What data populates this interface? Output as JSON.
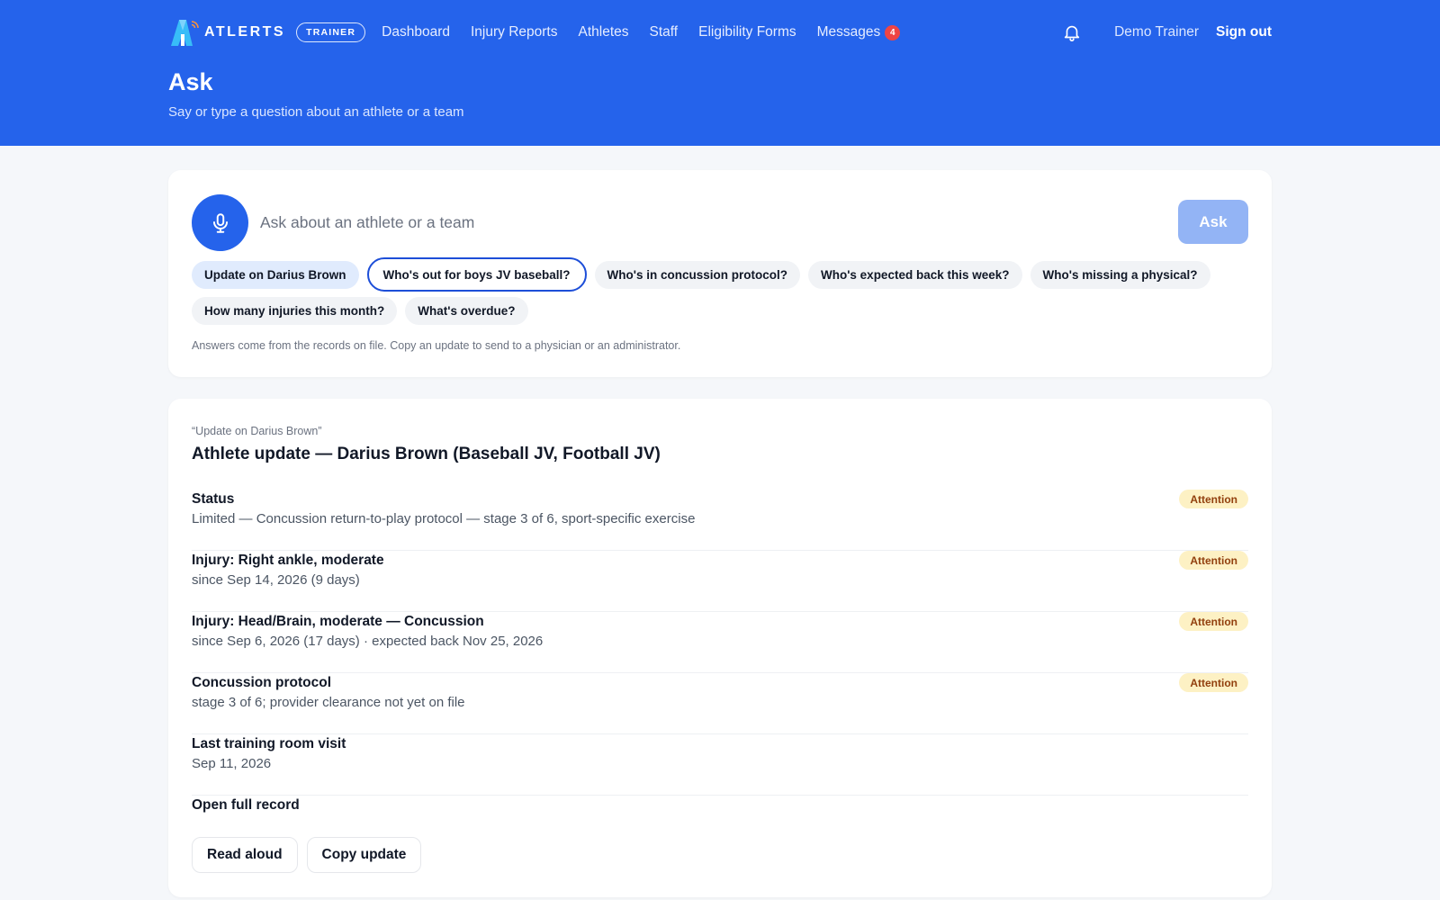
{
  "nav": {
    "brand": "ATLERTS",
    "role": "TRAINER",
    "links": [
      {
        "label": "Dashboard"
      },
      {
        "label": "Injury Reports"
      },
      {
        "label": "Athletes"
      },
      {
        "label": "Staff"
      },
      {
        "label": "Eligibility Forms"
      },
      {
        "label": "Messages",
        "badge": "4"
      }
    ],
    "user": "Demo Trainer",
    "signout": "Sign out"
  },
  "header": {
    "title": "Ask",
    "subtitle": "Say or type a question about an athlete or a team"
  },
  "ask": {
    "placeholder": "Ask about an athlete or a team",
    "value": "",
    "button": "Ask",
    "suggestions": [
      "Update on Darius Brown",
      "Who's out for boys JV baseball?",
      "Who's in concussion protocol?",
      "Who's expected back this week?",
      "Who's missing a physical?",
      "How many injuries this month?",
      "What's overdue?"
    ],
    "hint": "Answers come from the records on file. Copy an update to send to a physician or an administrator."
  },
  "answer": {
    "query": "“Update on Darius Brown”",
    "title": "Athlete update — Darius Brown (Baseball JV, Football JV)",
    "rows": [
      {
        "label": "Status",
        "value": "Limited — Concussion return-to-play protocol — stage 3 of 6, sport-specific exercise",
        "tag": "Attention"
      },
      {
        "label": "Injury: Right ankle, moderate",
        "value": "since Sep 14, 2026 (9 days)",
        "tag": "Attention"
      },
      {
        "label": "Injury: Head/Brain, moderate — Concussion",
        "value": "since Sep 6, 2026 (17 days) · expected back Nov 25, 2026",
        "tag": "Attention"
      },
      {
        "label": "Concussion protocol",
        "value": "stage 3 of 6; provider clearance not yet on file",
        "tag": "Attention"
      },
      {
        "label": "Last training room visit",
        "value": "Sep 11, 2026"
      }
    ],
    "open_record": "Open full record",
    "actions": {
      "read_aloud": "Read aloud",
      "copy_update": "Copy update"
    }
  },
  "colors": {
    "primary": "#2563eb",
    "attention_bg": "#fdf1c4",
    "attention_text": "#92400e",
    "badge": "#ef4444"
  }
}
